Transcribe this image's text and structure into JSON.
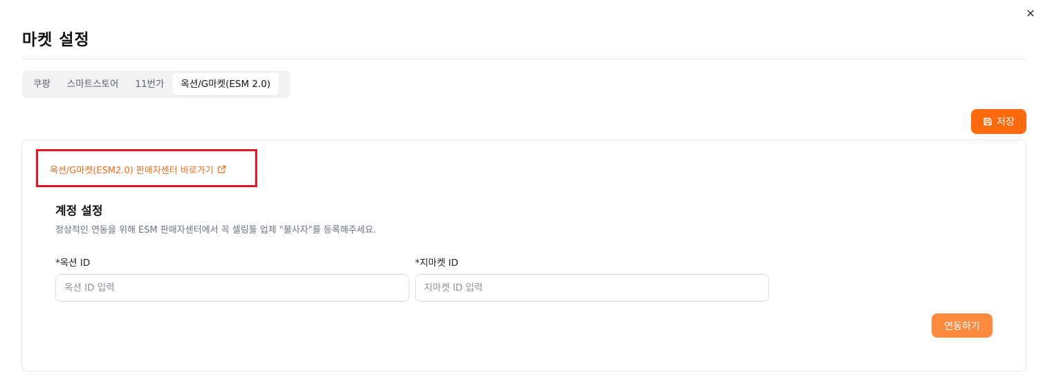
{
  "modal": {
    "title": "마켓 설정",
    "close_icon": "close-icon"
  },
  "tabs": [
    {
      "label": "쿠팡",
      "active": false
    },
    {
      "label": "스마트스토어",
      "active": false
    },
    {
      "label": "11번가",
      "active": false
    },
    {
      "label": "옥션/G마켓(ESM 2.0)",
      "active": true
    }
  ],
  "toolbar": {
    "save_label": "저장",
    "save_icon": "save-icon"
  },
  "card": {
    "seller_center_link": "옥션/G마켓(ESM2.0) 판매자센터 바로가기",
    "external_link_icon": "external-link-icon",
    "section_title": "계정 설정",
    "section_desc": "정상적인 연동을 위해 ESM 판매자센터에서 꼭 셀링툴 업체 \"불사자\"를 등록해주세요.",
    "auction_field": {
      "label": "*옥션 ID",
      "value": "",
      "placeholder": "옥션 ID 입력"
    },
    "gmarket_field": {
      "label": "*지마켓 ID",
      "value": "",
      "placeholder": "지마켓 ID 입력"
    },
    "connect_label": "연동하기"
  },
  "colors": {
    "accent": "#fd6a0e",
    "accent_light": "#fd8a3e",
    "highlight_box": "#e3141f"
  }
}
